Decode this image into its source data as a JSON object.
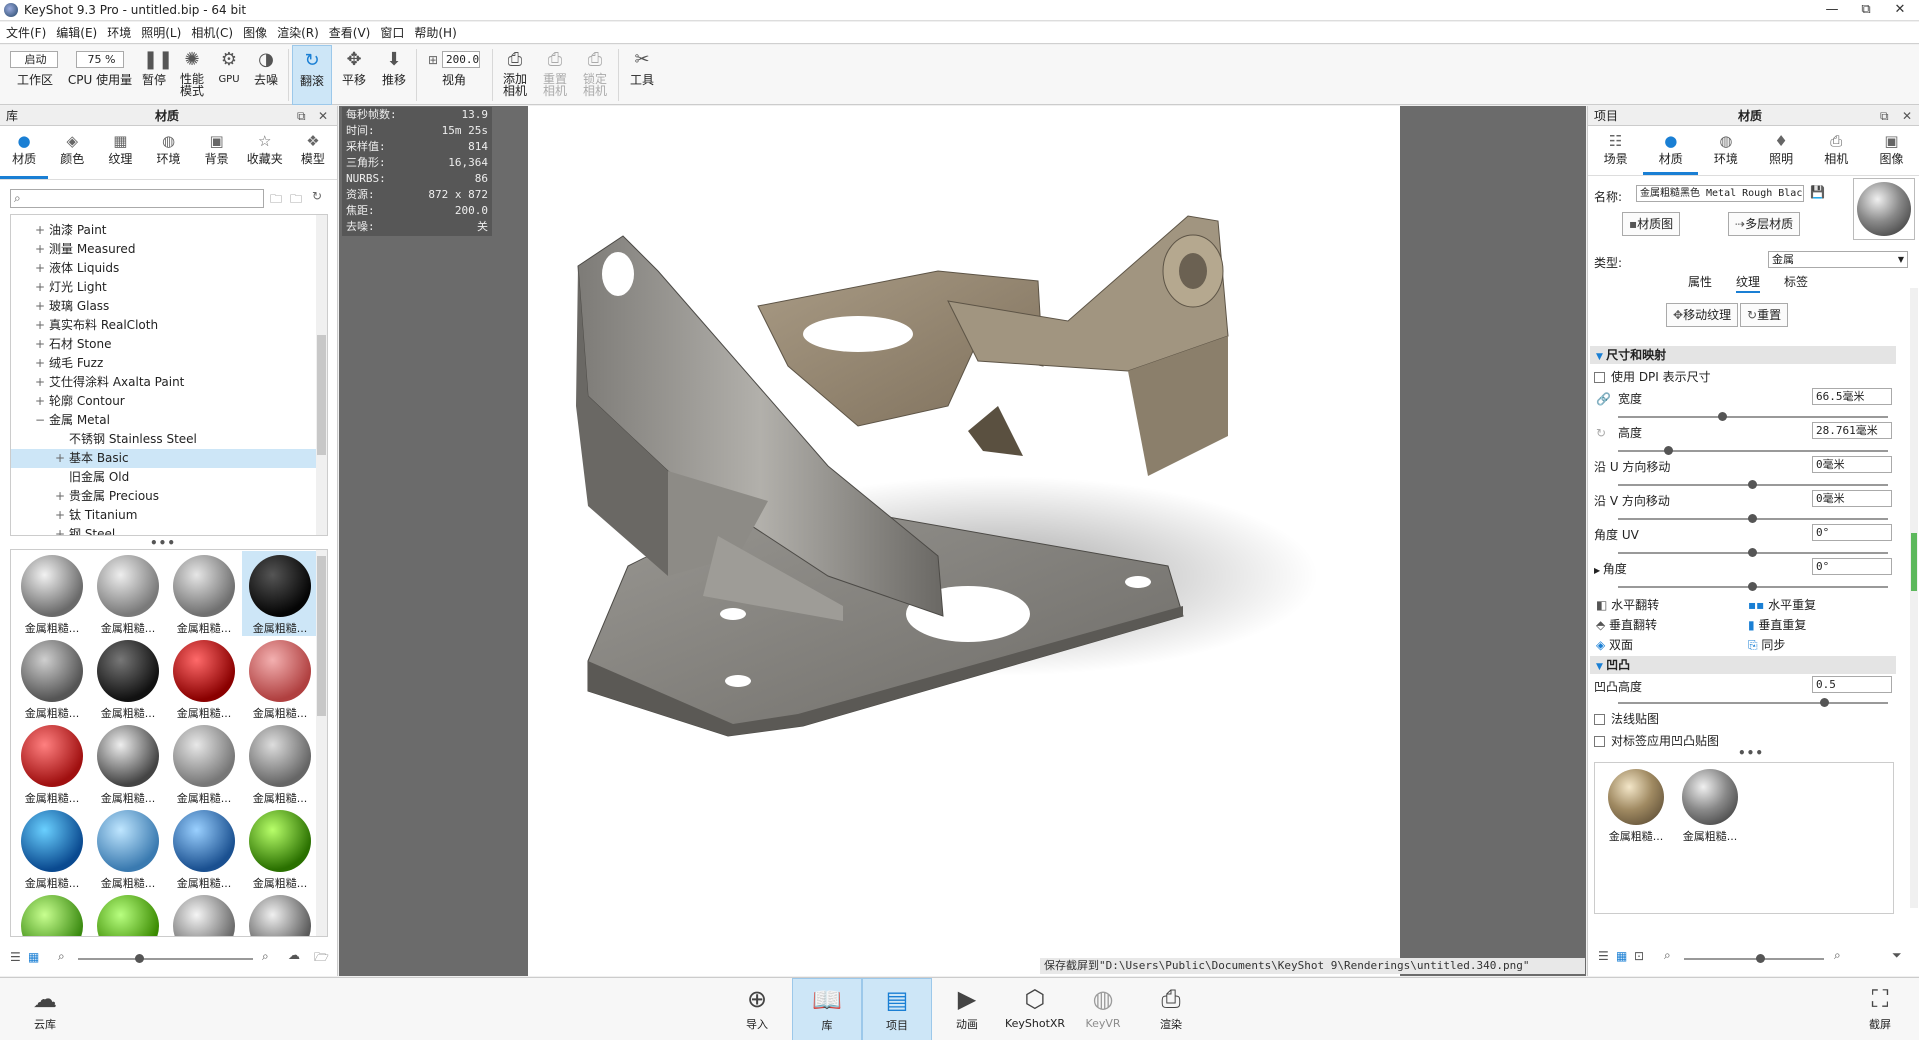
{
  "window": {
    "title": "KeyShot 9.3 Pro  - untitled.bip  - 64 bit",
    "controls": [
      "—",
      "⧉",
      "✕"
    ]
  },
  "menu": [
    "文件(F)",
    "编辑(E)",
    "环境",
    "照明(L)",
    "相机(C)",
    "图像",
    "渲染(R)",
    "查看(V)",
    "窗口",
    "帮助(H)"
  ],
  "toolbar": {
    "workspace_value": "启动",
    "workspace_label": "工作区",
    "cpu_value": "75 %",
    "cpu_label": "CPU 使用量",
    "pause": "暂停",
    "perf_mode": "性能\n模式",
    "gpu": "GPU",
    "denoise": "去噪",
    "tumble": "翻滚",
    "pan": "平移",
    "dolly": "推移",
    "fov_value": "200.0",
    "fov_label": "视角",
    "add_camera": "添加\n相机",
    "reset_camera": "重置\n相机",
    "lock_camera": "锁定\n相机",
    "tools": "工具"
  },
  "library": {
    "header_left": "库",
    "header_title": "材质",
    "tabs": [
      "材质",
      "颜色",
      "纹理",
      "环境",
      "背景",
      "收藏夹",
      "模型"
    ],
    "tree": [
      {
        "expander": "+",
        "label": "油漆 Paint",
        "indent": 0
      },
      {
        "expander": "+",
        "label": "测量 Measured",
        "indent": 0
      },
      {
        "expander": "+",
        "label": "液体 Liquids",
        "indent": 0
      },
      {
        "expander": "+",
        "label": "灯光 Light",
        "indent": 0
      },
      {
        "expander": "+",
        "label": "玻璃 Glass",
        "indent": 0
      },
      {
        "expander": "+",
        "label": "真实布料 RealCloth",
        "indent": 0
      },
      {
        "expander": "+",
        "label": "石材 Stone",
        "indent": 0
      },
      {
        "expander": "+",
        "label": "绒毛 Fuzz",
        "indent": 0
      },
      {
        "expander": "+",
        "label": "艾仕得涂料 Axalta Paint",
        "indent": 0
      },
      {
        "expander": "+",
        "label": "轮廓 Contour",
        "indent": 0
      },
      {
        "expander": "−",
        "label": "金属 Metal",
        "indent": 0
      },
      {
        "expander": "",
        "label": "不锈钢 Stainless Steel",
        "indent": 1
      },
      {
        "expander": "+",
        "label": "基本 Basic",
        "indent": 1,
        "selected": true
      },
      {
        "expander": "",
        "label": "旧金属 Old",
        "indent": 1
      },
      {
        "expander": "+",
        "label": "贵金属 Precious",
        "indent": 1
      },
      {
        "expander": "+",
        "label": "钛 Titanium",
        "indent": 1
      },
      {
        "expander": "+",
        "label": "钢 Steel",
        "indent": 1
      }
    ],
    "thumb_label": "金属粗糙...",
    "thumbs": [
      {
        "c1": "#f2f2f2",
        "c2": "#6a6a6a"
      },
      {
        "c1": "#eeeeee",
        "c2": "#7a7a7a"
      },
      {
        "c1": "#e6e6e6",
        "c2": "#707070"
      },
      {
        "c1": "#555555",
        "c2": "#050505",
        "selected": true
      },
      {
        "c1": "#cfcfcf",
        "c2": "#555555"
      },
      {
        "c1": "#777777",
        "c2": "#111111"
      },
      {
        "c1": "#ff6a6a",
        "c2": "#8a0000"
      },
      {
        "c1": "#f3b0b0",
        "c2": "#b04040"
      },
      {
        "c1": "#ff8080",
        "c2": "#a01010"
      },
      {
        "c1": "#eeeeee",
        "c2": "#444444"
      },
      {
        "c1": "#e8e8e8",
        "c2": "#777777"
      },
      {
        "c1": "#dddddd",
        "c2": "#666666"
      },
      {
        "c1": "#6ad0ff",
        "c2": "#0a4a90"
      },
      {
        "c1": "#bfe6ff",
        "c2": "#3a7ab0"
      },
      {
        "c1": "#9ad0ff",
        "c2": "#1a5090"
      },
      {
        "c1": "#b8ff6a",
        "c2": "#2a7000"
      },
      {
        "c1": "#c8ff90",
        "c2": "#3a8a10"
      },
      {
        "c1": "#b8ff80",
        "c2": "#3a8a00"
      },
      {
        "c1": "#f5f5f5",
        "c2": "#6a6a6a"
      },
      {
        "c1": "#f0f0f0",
        "c2": "#5a5a5a"
      }
    ],
    "more": "•••"
  },
  "stats": [
    {
      "k": "每秒帧数:",
      "v": "13.9"
    },
    {
      "k": "时间:",
      "v": "15m 25s"
    },
    {
      "k": "采样值:",
      "v": "814"
    },
    {
      "k": "三角形:",
      "v": "16,364"
    },
    {
      "k": "NURBS:",
      "v": "86"
    },
    {
      "k": "资源:",
      "v": "872 x 872"
    },
    {
      "k": "焦距:",
      "v": "200.0"
    },
    {
      "k": "去噪:",
      "v": "关"
    }
  ],
  "status_text": "保存截屏到\"D:\\Users\\Public\\Documents\\KeyShot 9\\Renderings\\untitled.340.png\"",
  "project": {
    "header_left": "项目",
    "header_title": "材质",
    "tabs": [
      "场景",
      "材质",
      "环境",
      "照明",
      "相机",
      "图像"
    ],
    "name_label": "名称:",
    "name_value": "金属粗糙黑色 Metal Rough Black",
    "graph_btn": "材质图",
    "multi_btn": "多层材质",
    "type_label": "类型:",
    "type_value": "金属",
    "subtabs": [
      "属性",
      "纹理",
      "标签"
    ],
    "move_texture": "移动纹理",
    "reset": "重置",
    "section_size": "尺寸和映射",
    "use_dpi": "使用 DPI 表示尺寸",
    "width_label": "宽度",
    "width_value": "66.5毫米",
    "height_label": "高度",
    "height_value": "28.761毫米",
    "u_label": "沿 U 方向移动",
    "u_value": "0毫米",
    "v_label": "沿 V 方向移动",
    "v_value": "0毫米",
    "uv_angle_label": "角度 UV",
    "uv_angle_value": "0°",
    "angle_label": "角度",
    "angle_value": "0°",
    "flip_h": "水平翻转",
    "repeat_h": "水平重复",
    "flip_v": "垂直翻转",
    "repeat_v": "垂直重复",
    "double_side": "双面",
    "sync": "同步",
    "section_bump": "凹凸",
    "bump_height_label": "凹凸高度",
    "bump_height_value": "0.5",
    "normal_map": "法线贴图",
    "apply_label_bump": "对标签应用凹凸贴图",
    "more": "•••",
    "material_thumbs": [
      "金属粗糙...",
      "金属粗糙..."
    ]
  },
  "bottom": [
    "云库",
    "导入",
    "库",
    "项目",
    "动画",
    "KeyShotXR",
    "KeyVR",
    "渲染",
    "截屏"
  ],
  "colors": {
    "accent": "#1a7fd4",
    "selected_bg": "#cde6f7"
  }
}
